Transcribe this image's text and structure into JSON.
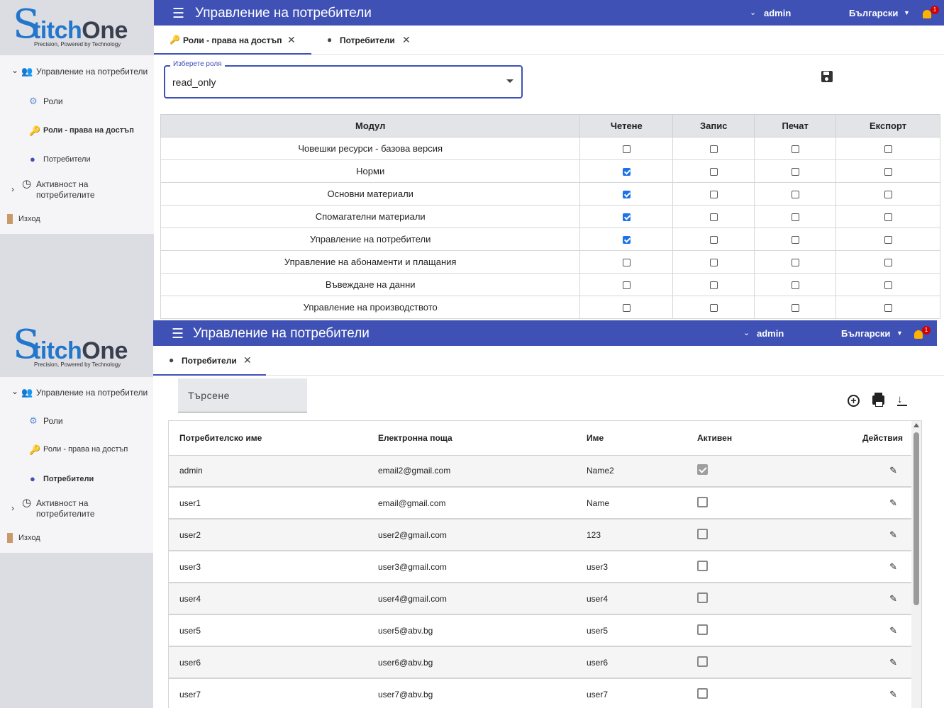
{
  "brand": {
    "logo_s": "S",
    "logo_titch": "titch",
    "logo_one": "One",
    "tagline": "Precision, Powered by Technology"
  },
  "header": {
    "title": "Управление на потребители",
    "user": "admin",
    "language": "Български",
    "notification_count": "1"
  },
  "sidebar": {
    "group_label": "Управление на потребители",
    "roles": "Роли",
    "roles_access": "Роли - права на достъп",
    "users": "Потребители",
    "activity_line1": "Активност на",
    "activity_line2": "потребителите",
    "logout": "Изход"
  },
  "pane_a": {
    "tabs": [
      {
        "label": "Роли - права на достъп"
      },
      {
        "label": "Потребители"
      }
    ],
    "role_select": {
      "legend": "Изберете роля",
      "value": "read_only"
    },
    "columns": [
      "Модул",
      "Четене",
      "Запис",
      "Печат",
      "Експорт"
    ],
    "rows": [
      {
        "module": "Човешки ресурси - базова версия",
        "read": false,
        "write": false,
        "print": false,
        "export": false
      },
      {
        "module": "Норми",
        "read": true,
        "write": false,
        "print": false,
        "export": false
      },
      {
        "module": "Основни материали",
        "read": true,
        "write": false,
        "print": false,
        "export": false
      },
      {
        "module": "Спомагателни материали",
        "read": true,
        "write": false,
        "print": false,
        "export": false
      },
      {
        "module": "Управление на потребители",
        "read": true,
        "write": false,
        "print": false,
        "export": false
      },
      {
        "module": "Управление на абонаменти и плащания",
        "read": false,
        "write": false,
        "print": false,
        "export": false
      },
      {
        "module": "Въвеждане на данни",
        "read": false,
        "write": false,
        "print": false,
        "export": false
      },
      {
        "module": "Управление на производството",
        "read": false,
        "write": false,
        "print": false,
        "export": false
      }
    ]
  },
  "pane_b": {
    "tabs": [
      {
        "label": "Потребители"
      }
    ],
    "search_placeholder": "Търсене",
    "columns": [
      "Потребителско име",
      "Електронна поща",
      "Име",
      "Активен",
      "Действия"
    ],
    "rows": [
      {
        "username": "admin",
        "email": "email2@gmail.com",
        "name": "Name2",
        "active": true
      },
      {
        "username": "user1",
        "email": "email@gmail.com",
        "name": "Name",
        "active": false
      },
      {
        "username": "user2",
        "email": "user2@gmail.com",
        "name": "123",
        "active": false
      },
      {
        "username": "user3",
        "email": "user3@gmail.com",
        "name": "user3",
        "active": false
      },
      {
        "username": "user4",
        "email": "user4@gmail.com",
        "name": "user4",
        "active": false
      },
      {
        "username": "user5",
        "email": "user5@abv.bg",
        "name": "user5",
        "active": false
      },
      {
        "username": "user6",
        "email": "user6@abv.bg",
        "name": "user6",
        "active": false
      },
      {
        "username": "user7",
        "email": "user7@abv.bg",
        "name": "user7",
        "active": false
      }
    ]
  },
  "icons": {
    "menu": "menu-icon",
    "close": "close-icon",
    "key": "key-icon",
    "person": "person-icon",
    "group": "group-icon",
    "clock": "clock-icon",
    "door": "door-icon",
    "save": "save-icon",
    "add": "add-circle-icon",
    "print": "print-icon",
    "download": "download-icon",
    "edit": "pencil-icon"
  },
  "colors": {
    "primary": "#3f51b5",
    "checkbox": "#1a73e8",
    "sidebar": "#dcdde2"
  }
}
